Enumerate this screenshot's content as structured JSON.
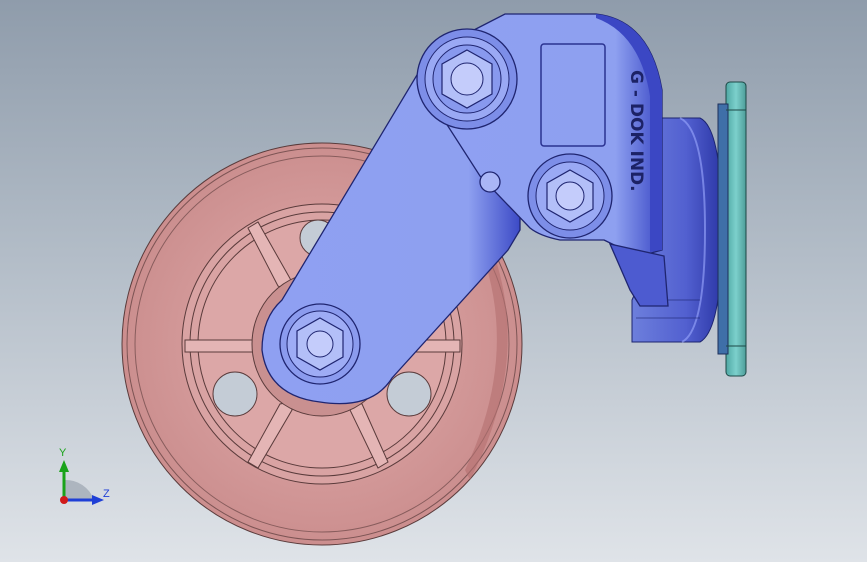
{
  "viewport": {
    "background_top": "#8f9cab",
    "background_bottom": "#dfe3e8"
  },
  "model": {
    "engraving": "G - DOK IND.",
    "colors": {
      "wheel": "#d49a9a",
      "wheel_edge": "#5a3b3b",
      "bracket": "#8d9ef0",
      "bracket_dark": "#4552c8",
      "mount_plate": "#6fbdbb",
      "nut": "#a9b6f7"
    }
  },
  "triad": {
    "y_label": "Y",
    "z_label": "Z",
    "y_color": "#1aa31a",
    "z_color": "#1f3fd6",
    "x_color": "#d01a1a"
  }
}
